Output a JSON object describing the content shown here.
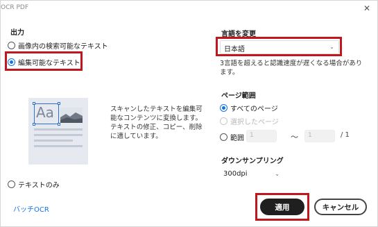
{
  "window": {
    "title": "OCR PDF",
    "close_icon": "close-icon"
  },
  "output": {
    "label": "出力",
    "options": [
      {
        "label": "画像内の検索可能なテキスト",
        "checked": false
      },
      {
        "label": "編集可能なテキスト",
        "checked": true
      },
      {
        "label": "テキストのみ",
        "checked": false
      }
    ],
    "description": "スキャンしたテキストを編集可能なコンテンツに変換します。テキストの修正、コピー、削除に適しています。"
  },
  "language": {
    "label": "言語を変更",
    "selected": "日本語",
    "note": "3言語を超えると認識速度が遅くなる場合があります。"
  },
  "page_range": {
    "label": "ページ範囲",
    "all_pages": "すべてのページ",
    "selected_pages": "選択したページ",
    "range_label": "範囲",
    "from_placeholder": "1",
    "to_placeholder": "1",
    "separator": "～",
    "total": "/ 1"
  },
  "downsampling": {
    "label": "ダウンサンプリング",
    "selected": "300dpi"
  },
  "footer": {
    "batch_link": "バッチOCR",
    "apply": "適用",
    "cancel": "キャンセル"
  },
  "colors": {
    "accent": "#1473e6",
    "highlight": "#c0161e",
    "apply_bg": "#1f1f1f"
  }
}
